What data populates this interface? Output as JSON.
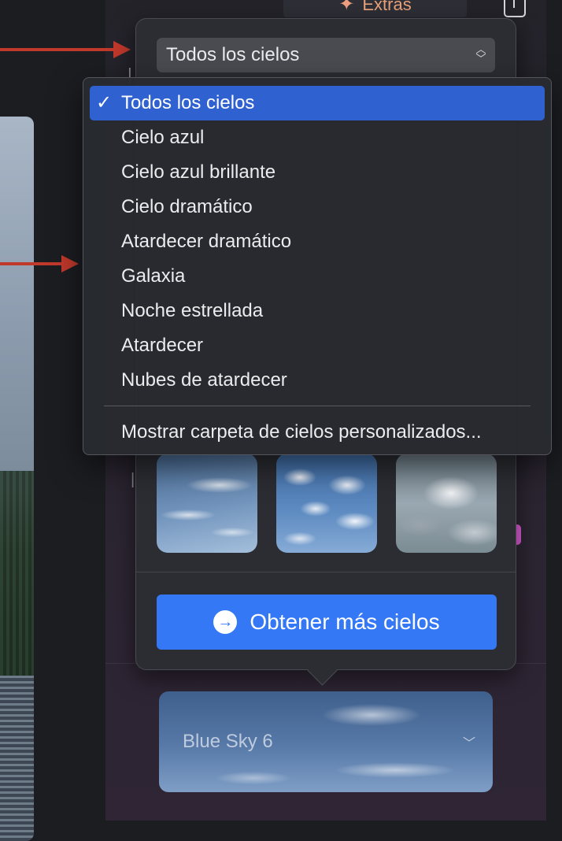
{
  "toolbar": {
    "extras_label": "Extras",
    "extras_icon": "puzzle-icon",
    "share_icon": "share-icon"
  },
  "popover": {
    "selected_category": "Todos los cielos",
    "get_more_label": "Obtener más cielos",
    "thumbnails": [
      "sky-thumbnail-1",
      "sky-thumbnail-2",
      "sky-thumbnail-3"
    ]
  },
  "menu": {
    "items": [
      {
        "label": "Todos los cielos",
        "checked": true
      },
      {
        "label": "Cielo azul"
      },
      {
        "label": "Cielo azul brillante"
      },
      {
        "label": "Cielo dramático"
      },
      {
        "label": "Atardecer dramático"
      },
      {
        "label": "Galaxia"
      },
      {
        "label": "Noche estrellada"
      },
      {
        "label": "Atardecer"
      },
      {
        "label": "Nubes de atardecer"
      }
    ],
    "custom_folder_label": "Mostrar carpeta de cielos personalizados...",
    "check_glyph": "✓"
  },
  "current_sky": {
    "name": "Blue Sky 6"
  },
  "colors": {
    "accent": "#3478f6",
    "menu_highlight": "#2f62d0",
    "annotation_arrow": "#c0392b"
  }
}
